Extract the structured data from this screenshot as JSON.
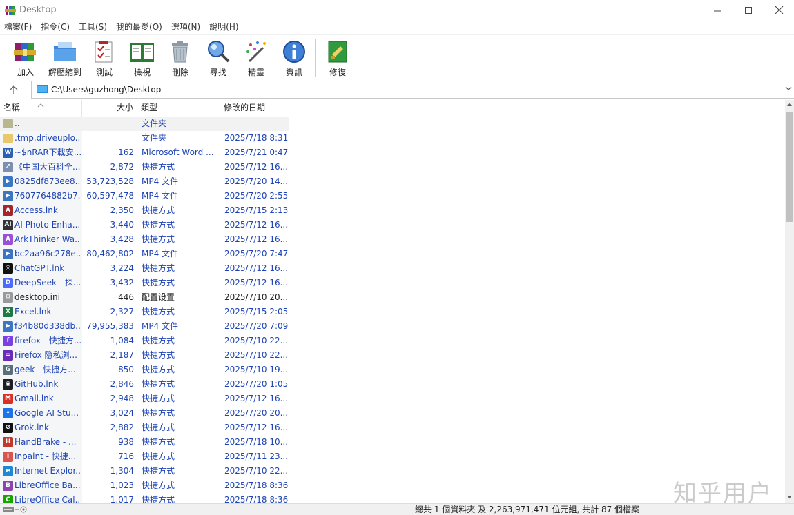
{
  "window": {
    "title": "Desktop"
  },
  "menu": [
    "檔案(F)",
    "指令(C)",
    "工具(S)",
    "我的最愛(O)",
    "選項(N)",
    "說明(H)"
  ],
  "toolbar": [
    {
      "label": "加入",
      "icon": "add-archive-icon"
    },
    {
      "label": "解壓縮到",
      "icon": "extract-to-icon"
    },
    {
      "label": "測試",
      "icon": "test-icon"
    },
    {
      "label": "檢視",
      "icon": "view-icon"
    },
    {
      "label": "刪除",
      "icon": "delete-icon"
    },
    {
      "label": "尋找",
      "icon": "find-icon"
    },
    {
      "label": "精靈",
      "icon": "wizard-icon"
    },
    {
      "label": "資訊",
      "icon": "info-icon"
    },
    {
      "label": "修復",
      "icon": "repair-icon"
    }
  ],
  "path": {
    "value": "C:\\Users\\guzhong\\Desktop"
  },
  "columns": {
    "name": "名稱",
    "size": "大小",
    "type": "類型",
    "modified": "修改的日期"
  },
  "files": [
    {
      "name": "..",
      "size": "",
      "type": "文件夹",
      "modified": "",
      "icon": "folder-icon"
    },
    {
      "name": ".tmp.driveuplo...",
      "size": "",
      "type": "文件夹",
      "modified": "2025/7/18 8:31",
      "icon": "folder-icon"
    },
    {
      "name": "~$nRAR下載安...",
      "size": "162",
      "type": "Microsoft Word ...",
      "modified": "2025/7/21 0:47",
      "icon": "word-icon"
    },
    {
      "name": "《中国大百科全...",
      "size": "2,872",
      "type": "快捷方式",
      "modified": "2025/7/12 16...",
      "icon": "shortcut-icon"
    },
    {
      "name": "0825df873ee8...",
      "size": "53,723,528",
      "type": "MP4 文件",
      "modified": "2025/7/20 14...",
      "icon": "video-icon"
    },
    {
      "name": "7607764882b7...",
      "size": "60,597,478",
      "type": "MP4 文件",
      "modified": "2025/7/20 2:55",
      "icon": "video-icon"
    },
    {
      "name": "Access.lnk",
      "size": "2,350",
      "type": "快捷方式",
      "modified": "2025/7/15 2:13",
      "icon": "access-icon"
    },
    {
      "name": "AI Photo Enha...",
      "size": "3,440",
      "type": "快捷方式",
      "modified": "2025/7/12 16...",
      "icon": "ai-photo-icon"
    },
    {
      "name": "ArkThinker Wa...",
      "size": "3,428",
      "type": "快捷方式",
      "modified": "2025/7/12 16...",
      "icon": "arkthinker-icon"
    },
    {
      "name": "bc2aa96c278e...",
      "size": "80,462,802",
      "type": "MP4 文件",
      "modified": "2025/7/20 7:47",
      "icon": "video-icon"
    },
    {
      "name": "ChatGPT.lnk",
      "size": "3,224",
      "type": "快捷方式",
      "modified": "2025/7/12 16...",
      "icon": "chatgpt-icon"
    },
    {
      "name": "DeepSeek - 探...",
      "size": "3,432",
      "type": "快捷方式",
      "modified": "2025/7/12 16...",
      "icon": "deepseek-icon"
    },
    {
      "name": "desktop.ini",
      "size": "446",
      "type": "配置设置",
      "modified": "2025/7/10 20...",
      "icon": "settings-file-icon",
      "dark": true
    },
    {
      "name": "Excel.lnk",
      "size": "2,327",
      "type": "快捷方式",
      "modified": "2025/7/15 2:05",
      "icon": "excel-icon"
    },
    {
      "name": "f34b80d338db...",
      "size": "79,955,383",
      "type": "MP4 文件",
      "modified": "2025/7/20 7:09",
      "icon": "video-icon"
    },
    {
      "name": "firefox - 快捷方...",
      "size": "1,084",
      "type": "快捷方式",
      "modified": "2025/7/10 22...",
      "icon": "firefox-icon"
    },
    {
      "name": "Firefox 隐私浏...",
      "size": "2,187",
      "type": "快捷方式",
      "modified": "2025/7/10 22...",
      "icon": "firefox-private-icon"
    },
    {
      "name": "geek - 快捷方...",
      "size": "850",
      "type": "快捷方式",
      "modified": "2025/7/10 19...",
      "icon": "geek-icon"
    },
    {
      "name": "GitHub.lnk",
      "size": "2,846",
      "type": "快捷方式",
      "modified": "2025/7/20 1:05",
      "icon": "github-icon"
    },
    {
      "name": "Gmail.lnk",
      "size": "2,948",
      "type": "快捷方式",
      "modified": "2025/7/12 16...",
      "icon": "gmail-icon"
    },
    {
      "name": "Google AI Stu...",
      "size": "3,024",
      "type": "快捷方式",
      "modified": "2025/7/20 20...",
      "icon": "google-ai-studio-icon"
    },
    {
      "name": "Grok.lnk",
      "size": "2,882",
      "type": "快捷方式",
      "modified": "2025/7/12 16...",
      "icon": "grok-icon"
    },
    {
      "name": "HandBrake - ...",
      "size": "938",
      "type": "快捷方式",
      "modified": "2025/7/18 10...",
      "icon": "handbrake-icon"
    },
    {
      "name": "Inpaint - 快捷...",
      "size": "716",
      "type": "快捷方式",
      "modified": "2025/7/11 23...",
      "icon": "inpaint-icon"
    },
    {
      "name": "Internet Explor...",
      "size": "1,304",
      "type": "快捷方式",
      "modified": "2025/7/10 22...",
      "icon": "internet-explorer-icon"
    },
    {
      "name": "LibreOffice Ba...",
      "size": "1,023",
      "type": "快捷方式",
      "modified": "2025/7/18 8:36",
      "icon": "libreoffice-base-icon"
    },
    {
      "name": "LibreOffice Cal...",
      "size": "1,017",
      "type": "快捷方式",
      "modified": "2025/7/18 8:36",
      "icon": "libreoffice-calc-icon"
    }
  ],
  "status": {
    "summary": "總共 1 個資料夾 及 2,263,971,471 位元組, 共計 87 個檔案"
  },
  "watermark": "知乎用户"
}
